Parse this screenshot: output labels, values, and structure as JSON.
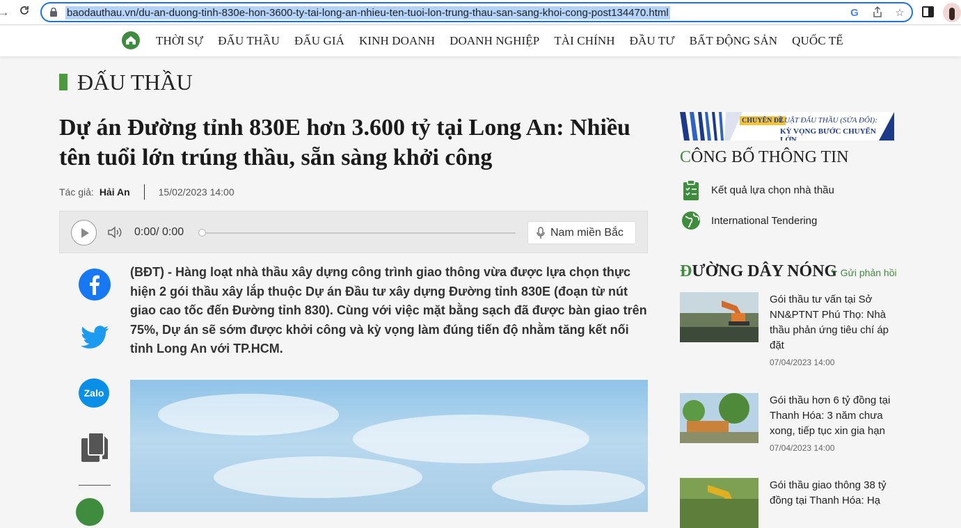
{
  "browser": {
    "url": "baodauthau.vn/du-an-duong-tinh-830e-hon-3600-ty-tai-long-an-nhieu-ten-tuoi-lon-trung-thau-san-sang-khoi-cong-post134470.html"
  },
  "nav": {
    "items": [
      "THỜI SỰ",
      "ĐẤU THẦU",
      "ĐẤU GIÁ",
      "KINH DOANH",
      "DOANH NGHIỆP",
      "TÀI CHÍNH",
      "ĐẦU TƯ",
      "BẤT ĐỘNG SẢN",
      "QUỐC TẾ"
    ]
  },
  "article": {
    "section": "ĐẤU THẦU",
    "title": "Dự án Đường tỉnh 830E hơn 3.600 tỷ tại Long An: Nhiều tên tuổi lớn trúng thầu, sẵn sàng khởi công",
    "author_label": "Tác giả:",
    "author": "Hải An",
    "date": "15/02/2023 14:00",
    "sapo": "(BĐT) - Hàng loạt nhà thầu xây dựng công trình giao thông vừa được lựa chọn thực hiện 2 gói thầu xây lắp thuộc Dự án Đầu tư xây dựng Đường tỉnh 830E (đoạn từ nút giao cao tốc đến Đường tỉnh 830). Cùng với việc mặt bằng sạch đã được bàn giao trên 75%, Dự án sẽ sớm được khởi công và kỳ vọng làm đúng tiến độ nhằm tăng kết nối tỉnh Long An với TP.HCM."
  },
  "player": {
    "time": "0:00/ 0:00",
    "voice": "Nam miền Bắc"
  },
  "share": {
    "zalo": "Zalo"
  },
  "sidebar": {
    "banner": {
      "tag": "CHUYÊN ĐỀ",
      "line1": "LUẬT ĐẤU THẦU (SỬA ĐỔI):",
      "line2": "KỲ VỌNG BƯỚC CHUYỂN LỚN"
    },
    "disclosure": {
      "title_first": "C",
      "title_rest": "ÔNG BỐ THÔNG TIN",
      "items": [
        "Kết quả lựa chọn nhà thầu",
        "International Tendering"
      ]
    },
    "hotline": {
      "title_first": "Đ",
      "title_rest": "ƯỜNG DÂY NÓNG",
      "feedback": "Gửi phản hồi"
    },
    "news": [
      {
        "title": "Gói thầu tư vấn tại Sở NN&PTNT Phú Thọ: Nhà thầu phản ứng tiêu chí áp đặt",
        "date": "07/04/2023 14:00"
      },
      {
        "title": "Gói thầu hơn 6 tỷ đồng tại Thanh Hóa: 3 năm chưa xong, tiếp tục xin gia hạn",
        "date": "07/04/2023 14:00"
      },
      {
        "title": "Gói thầu giao thông 38 tỷ đồng tại Thanh Hóa: Hạ"
      }
    ]
  },
  "colors": {
    "brand_green": "#3f8c3f",
    "url_focus": "#1a73e8",
    "facebook": "#1877f2",
    "zalo": "#0a8fe8"
  }
}
